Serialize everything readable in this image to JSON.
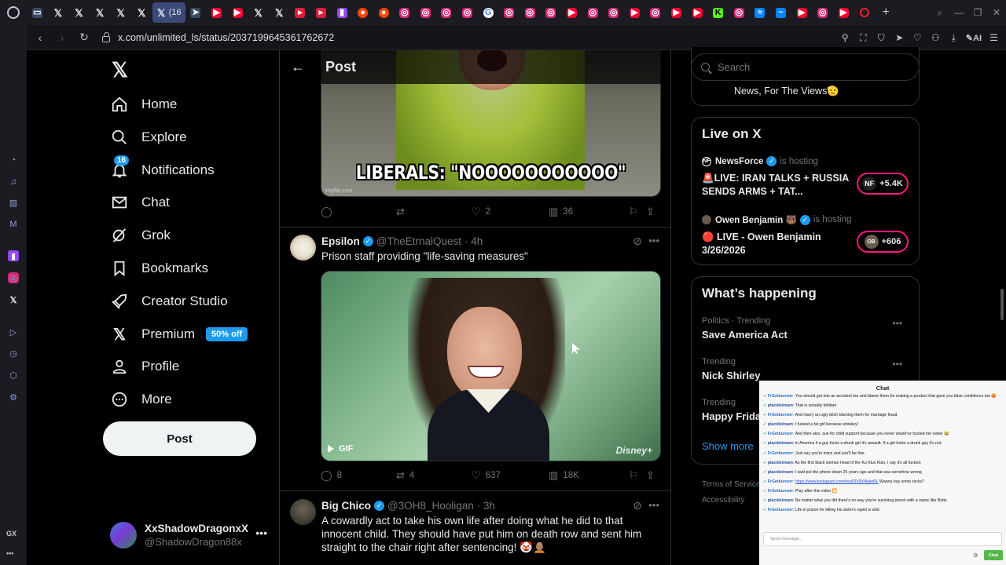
{
  "browser": {
    "tabs": [
      {
        "icon": "photo-icon",
        "favclass": "gr",
        "glyph": "▭"
      },
      {
        "icon": "x-icon",
        "favclass": "x",
        "glyph": "𝕏"
      },
      {
        "icon": "x-icon",
        "favclass": "x",
        "glyph": "𝕏"
      },
      {
        "icon": "x-icon",
        "favclass": "x",
        "glyph": "𝕏"
      },
      {
        "icon": "x-icon",
        "favclass": "x",
        "glyph": "𝕏"
      },
      {
        "icon": "x-icon",
        "favclass": "x",
        "glyph": "𝕏"
      },
      {
        "icon": "x-icon",
        "favclass": "x",
        "glyph": "𝕏",
        "active": true,
        "label": "(16"
      },
      {
        "icon": "arrow-icon",
        "favclass": "gr",
        "glyph": "➤"
      },
      {
        "icon": "youtube-icon",
        "favclass": "yt",
        "glyph": "▶"
      },
      {
        "icon": "youtube-icon",
        "favclass": "yt",
        "glyph": "▶"
      },
      {
        "icon": "x-icon",
        "favclass": "x",
        "glyph": "𝕏"
      },
      {
        "icon": "x-icon",
        "favclass": "x",
        "glyph": "𝕏"
      },
      {
        "icon": "flag-icon",
        "favclass": "ar",
        "glyph": "▸"
      },
      {
        "icon": "flag-icon",
        "favclass": "ar",
        "glyph": "▸"
      },
      {
        "icon": "twitch-icon",
        "favclass": "tw",
        "glyph": "▮"
      },
      {
        "icon": "reddit-icon",
        "favclass": "rd",
        "glyph": "●"
      },
      {
        "icon": "reddit-icon",
        "favclass": "rd",
        "glyph": "●"
      },
      {
        "icon": "instagram-icon",
        "favclass": "ig",
        "glyph": "◎"
      },
      {
        "icon": "instagram-icon",
        "favclass": "ig",
        "glyph": "◎"
      },
      {
        "icon": "instagram-icon",
        "favclass": "ig",
        "glyph": "◎"
      },
      {
        "icon": "instagram-icon",
        "favclass": "ig",
        "glyph": "◎"
      },
      {
        "icon": "google-icon",
        "favclass": "gg",
        "glyph": "G"
      },
      {
        "icon": "instagram-icon",
        "favclass": "ig",
        "glyph": "◎"
      },
      {
        "icon": "instagram-icon",
        "favclass": "ig",
        "glyph": "◎"
      },
      {
        "icon": "instagram-icon",
        "favclass": "ig",
        "glyph": "◎"
      },
      {
        "icon": "youtube-icon",
        "favclass": "yt",
        "glyph": "▶"
      },
      {
        "icon": "instagram-icon",
        "favclass": "ig",
        "glyph": "◎"
      },
      {
        "icon": "instagram-icon",
        "favclass": "ig",
        "glyph": "◎"
      },
      {
        "icon": "youtube-icon",
        "favclass": "yt",
        "glyph": "▶"
      },
      {
        "icon": "instagram-icon",
        "favclass": "ig",
        "glyph": "◎"
      },
      {
        "icon": "youtube-icon",
        "favclass": "yt",
        "glyph": "▶"
      },
      {
        "icon": "youtube-icon",
        "favclass": "yt",
        "glyph": "▶"
      },
      {
        "icon": "kick-icon",
        "favclass": "kk",
        "glyph": "K"
      },
      {
        "icon": "instagram-icon",
        "favclass": "ig",
        "glyph": "◎"
      },
      {
        "icon": "bluesky-icon",
        "favclass": "bl",
        "glyph": "≈"
      },
      {
        "icon": "gx-icon",
        "favclass": "bl",
        "glyph": "~"
      },
      {
        "icon": "youtube-icon",
        "favclass": "yt",
        "glyph": "▶"
      },
      {
        "icon": "instagram-icon",
        "favclass": "ig",
        "glyph": "◎"
      },
      {
        "icon": "youtube-icon",
        "favclass": "yt",
        "glyph": "▶"
      },
      {
        "icon": "opera-icon",
        "favclass": "op",
        "glyph": ""
      }
    ],
    "url": "x.com/unlimited_ls/status/2037199645361762672"
  },
  "nav": {
    "home": "Home",
    "explore": "Explore",
    "notifications": "Notifications",
    "notifications_count": "16",
    "chat": "Chat",
    "grok": "Grok",
    "bookmarks": "Bookmarks",
    "creator_studio": "Creator Studio",
    "premium": "Premium",
    "premium_badge": "50% off",
    "profile": "Profile",
    "more": "More",
    "post_button": "Post"
  },
  "account": {
    "name": "XxShadowDragonxX",
    "handle": "@ShadowDragon88x"
  },
  "header": {
    "title": "Post"
  },
  "tweets": [
    {
      "meme_text": "LIBERALS: \"NOOOOOOOOOOO\"",
      "watermark": "imgflip.com",
      "replies": "",
      "reposts": "",
      "likes": "2",
      "views": "36"
    },
    {
      "name": "Epsilon",
      "handle": "@TheEtrnalQuest",
      "time": "· 4h",
      "text": "Prison staff providing \"life-saving measures\"",
      "gif_label": "GIF",
      "brand": "Disney+",
      "replies": "8",
      "reposts": "4",
      "likes": "637",
      "views": "18K"
    },
    {
      "name": "Big Chico",
      "handle": "@3OH8_Hooligan",
      "time": "· 3h",
      "text": "A cowardly act to take his own life after doing what he did to that innocent child. They should have put him on death row and sent him straight to the chair right after sentencing! 🤡🧑🏽‍🦲"
    }
  ],
  "search": {
    "placeholder": "Search"
  },
  "news_card": {
    "text": "News, For The Views🫡"
  },
  "live": {
    "title": "Live on X",
    "items": [
      {
        "host": "NewsForce",
        "status": "is hosting",
        "title": "🚨LIVE:  IRAN TALKS + RUSSIA SENDS ARMS + TAT...",
        "count": "+5.4K",
        "pill_icon": "NF"
      },
      {
        "host": "Owen Benjamin 🐻",
        "status": "is hosting",
        "title": "🔴 LIVE - Owen Benjamin 3/26/2026",
        "count": "+606",
        "pill_icon": "OB"
      }
    ]
  },
  "happening": {
    "title": "What’s happening",
    "trends": [
      {
        "category": "Politics · Trending",
        "name": "Save America Act"
      },
      {
        "category": "Trending",
        "name": "Nick Shirley"
      },
      {
        "category": "Trending",
        "name": "Happy Frida"
      }
    ],
    "show_more": "Show more"
  },
  "footer": {
    "terms": "Terms of Service",
    "accessibility": "Accessibility"
  },
  "chat_overlay": {
    "title": "Chat",
    "messages": [
      {
        "user": "FrGetburnerr",
        "ucls": "a",
        "text": ": You should get into an accident too and blame them for making a product that gave you false confidence too 😡"
      },
      {
        "user": "placidstream",
        "ucls": "b",
        "text": ": That is actually brilliant"
      },
      {
        "user": "FrGetburnerr",
        "ucls": "a",
        "text": ": And marry an ugly bitch blaming them for marriage fraud"
      },
      {
        "user": "placidstream",
        "ucls": "b",
        "text": ": I fucked a fat girl because whiskey!"
      },
      {
        "user": "FrGetburnerr",
        "ucls": "a",
        "text": ": And then also, sue for child support because you never would've fucked her sober 😂"
      },
      {
        "user": "placidstream",
        "ucls": "b",
        "text": ": In America if a guy fucks a drunk girl it's assault. If a girl fucks a drunk guy it's not."
      },
      {
        "user": "FrGetburnerr",
        "ucls": "a",
        "text": ": Just say you're trans and you'll be fine."
      },
      {
        "user": "placidstream",
        "ucls": "b",
        "text": ": As the first black woman head of the Ku Klux Klan, I say it's all fucked."
      },
      {
        "user": "placidstream",
        "ucls": "b",
        "text": ": I said put the phone down 25 years ago and that was somehow wrong"
      },
      {
        "user": "FrGetburnerr",
        "ucls": "a",
        "text": ": ",
        "link": "https://www.instagram.com/reel/DV9X4lykeRL",
        "after": " Wanna buy some rocks?"
      },
      {
        "user": "FrGetburnerr",
        "ucls": "a",
        "text": ": Play after this video 🎦"
      },
      {
        "user": "placidstream",
        "ucls": "b",
        "text": ": No matter what you did there's no way you're surviving prison with a name like Butts"
      },
      {
        "user": "FrGetburnerr",
        "ucls": "a",
        "text": ": Life in prison for killing his sister's rapist is wild."
      }
    ],
    "input_placeholder": "Send message...",
    "send_button": "Chat"
  }
}
